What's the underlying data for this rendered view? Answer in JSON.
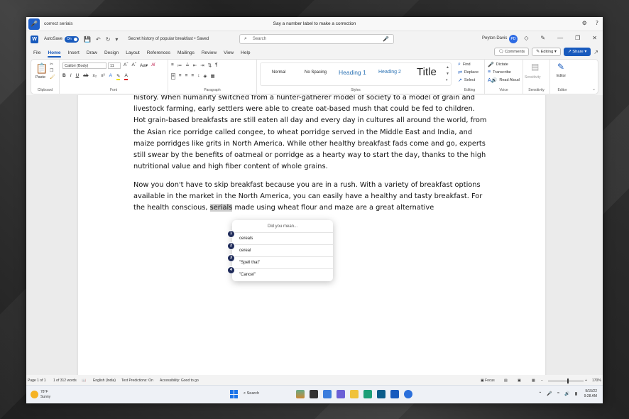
{
  "voice": {
    "command": "correct serials",
    "hint": "Say a number label to make a correction"
  },
  "titlebar": {
    "autosave_label": "AutoSave",
    "autosave_state": "On",
    "doc_title": "Secret history of popular breakfast • Saved",
    "search_placeholder": "Search",
    "user_name": "Peyton Davis",
    "user_initials": "PD"
  },
  "menu": {
    "tabs": [
      "File",
      "Home",
      "Insert",
      "Draw",
      "Design",
      "Layout",
      "References",
      "Mailings",
      "Review",
      "View",
      "Help"
    ],
    "comments": "Comments",
    "editing": "Editing",
    "share": "Share"
  },
  "ribbon": {
    "paste": "Paste",
    "clipboard": "Clipboard",
    "font_name": "Calibri (Body)",
    "font_size": "11",
    "font": "Font",
    "paragraph": "Paragraph",
    "styles": [
      "Normal",
      "No Spacing",
      "Heading 1",
      "Heading 2",
      "Title"
    ],
    "styles_label": "Styles",
    "find": "Find",
    "replace": "Replace",
    "select": "Select",
    "editing_label": "Editing",
    "dictate": "Dictate",
    "transcribe": "Transcribe",
    "read_aloud": "Read Aloud",
    "voice_label": "Voice",
    "sensitivity": "Sensitivity",
    "editor": "Editor"
  },
  "document": {
    "para1": "history. When humanity switched from a hunter-gatherer model of society to a model of grain and livestock farming, early settlers were able to create oat-based mush that could be fed to children. Hot grain-based breakfasts are still eaten all day and every day in cultures all around the world, from the Asian rice porridge called congee, to wheat porridge served in the Middle East and India, and maize porridges like grits in North America. While other healthy breakfast fads come and go, experts still swear by the benefits of oatmeal or porridge as a hearty way to start the day, thanks to the high nutritional value and high fiber content of whole grains.",
    "para2_before": "Now you don't have to skip breakfast because you are in a rush. With a variety of breakfast options available in the market in the North America, you can easily have a healthy and tasty breakfast. For the health conscious, ",
    "para2_highlight": "serials",
    "para2_after": " made using wheat flour and maze are a great alternative"
  },
  "popup": {
    "title": "Did you mean...",
    "options": [
      {
        "num": "1",
        "label": "cereals"
      },
      {
        "num": "2",
        "label": "cereal"
      },
      {
        "num": "3",
        "label": "\"Spell that\""
      },
      {
        "num": "4",
        "label": "\"Cancel\""
      }
    ]
  },
  "statusbar": {
    "page": "Page 1 of 1",
    "words": "1 of 312 words",
    "language": "English (India)",
    "predictions": "Text Predictions: On",
    "accessibility": "Accessibility: Good to go",
    "focus": "Focus",
    "zoom": "170%"
  },
  "taskbar": {
    "temp": "78°F",
    "condition": "Sunny",
    "search": "Search",
    "date": "9/15/22",
    "time": "9:28 AM"
  }
}
